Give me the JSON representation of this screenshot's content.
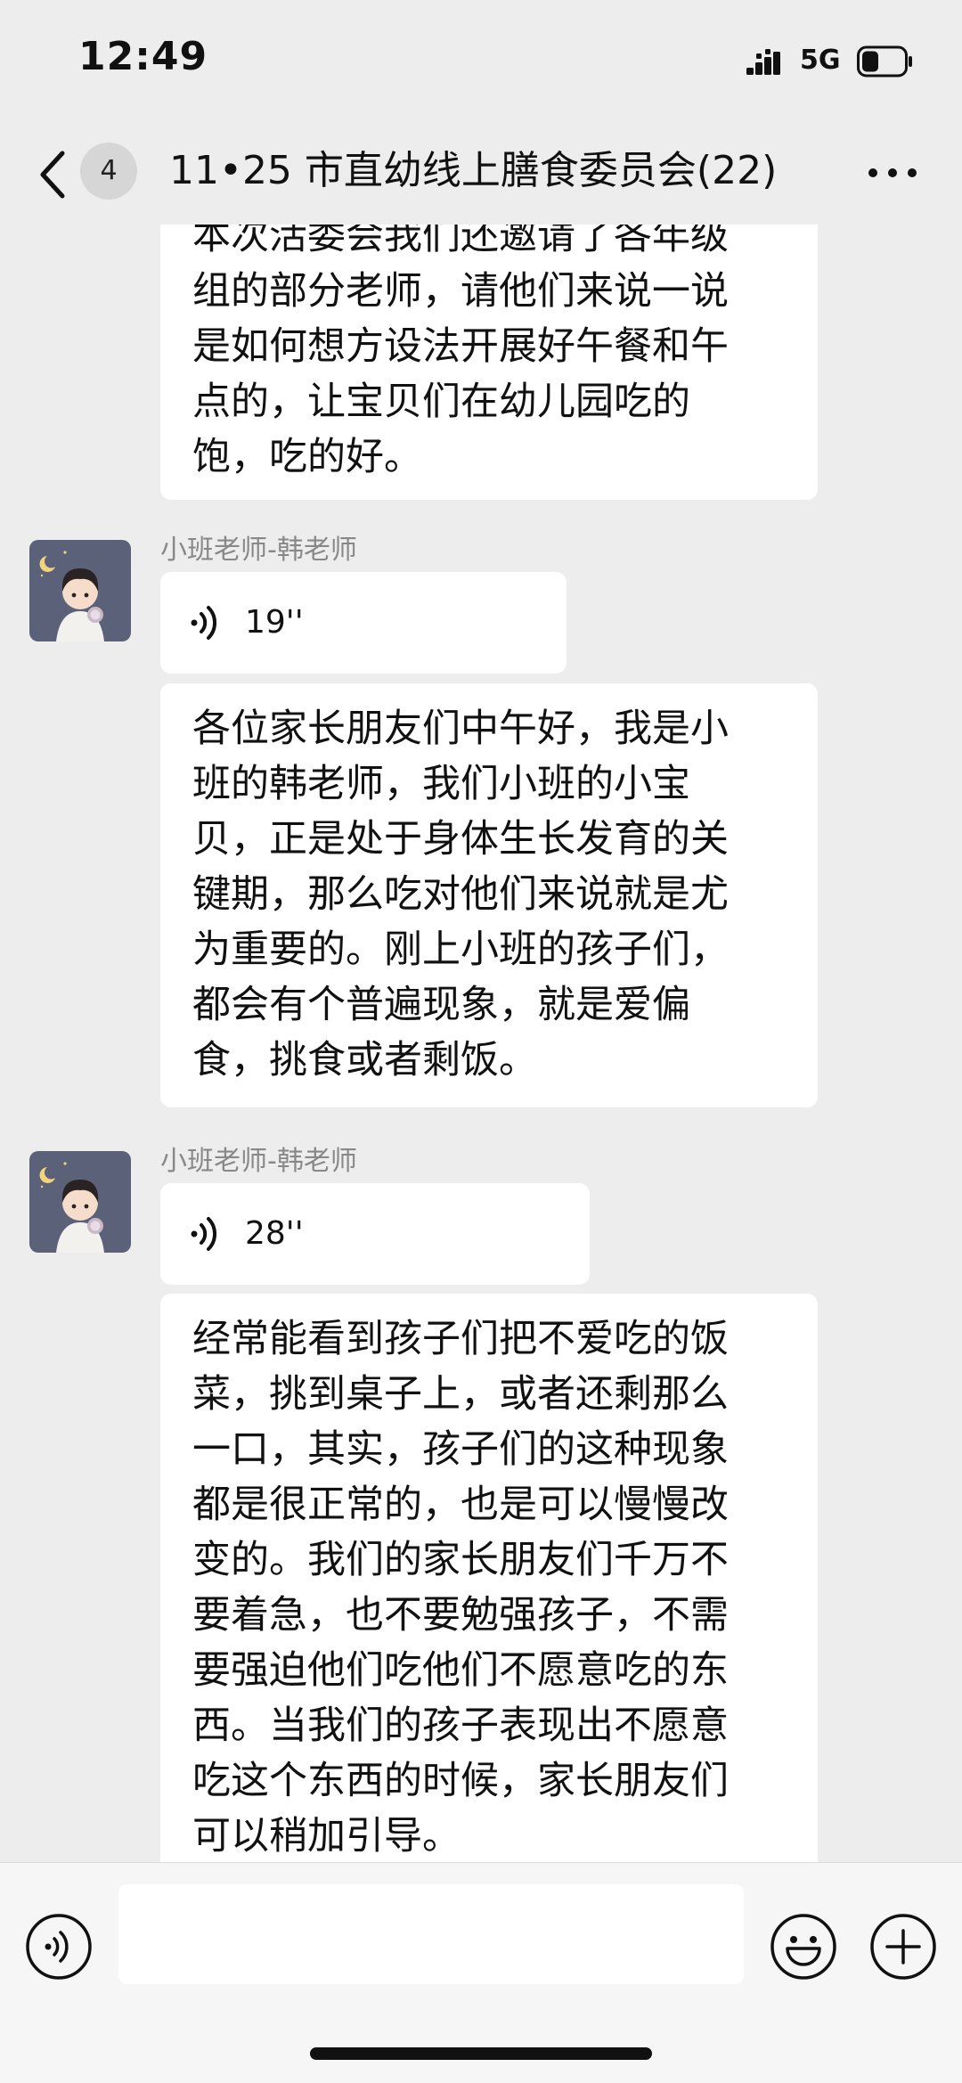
{
  "status_bar": {
    "time": "12:49",
    "network": "5G",
    "battery_level": 0.4
  },
  "nav": {
    "unread_count": "4",
    "title": "11•25 市直幼线上膳食委员会(22)"
  },
  "messages": [
    {
      "type": "text",
      "lines": [
        "本次活委会我们还邀请了各年级",
        "组的部分老师，请他们来说一说",
        "是如何想方设法开展好午餐和午",
        "点的，让宝贝们在幼儿园吃的",
        "饱，吃的好。"
      ]
    },
    {
      "type": "voice",
      "sender": "小班老师-韩老师",
      "duration": "19''"
    },
    {
      "type": "text",
      "lines": [
        "各位家长朋友们中午好，我是小",
        "班的韩老师，我们小班的小宝",
        "贝，正是处于身体生长发育的关",
        "键期，那么吃对他们来说就是尤",
        "为重要的。刚上小班的孩子们，",
        "都会有个普遍现象，就是爱偏",
        "食，挑食或者剩饭。"
      ]
    },
    {
      "type": "voice",
      "sender": "小班老师-韩老师",
      "duration": "28''"
    },
    {
      "type": "text",
      "lines": [
        "经常能看到孩子们把不爱吃的饭",
        "菜，挑到桌子上，或者还剩那么",
        "一口，其实，孩子们的这种现象",
        "都是很正常的，也是可以慢慢改",
        "变的。我们的家长朋友们千万不",
        "要着急，也不要勉强孩子，不需",
        "要强迫他们吃他们不愿意吃的东",
        "西。当我们的孩子表现出不愿意",
        "吃这个东西的时候，家长朋友们",
        "可以稍加引导。"
      ]
    }
  ],
  "input_bar": {
    "placeholder": ""
  },
  "icons": {
    "back": "chevron-left-icon",
    "more": "more-dots-icon",
    "voice_mode": "voice-mode-icon",
    "emoji": "emoji-icon",
    "add": "plus-icon"
  }
}
